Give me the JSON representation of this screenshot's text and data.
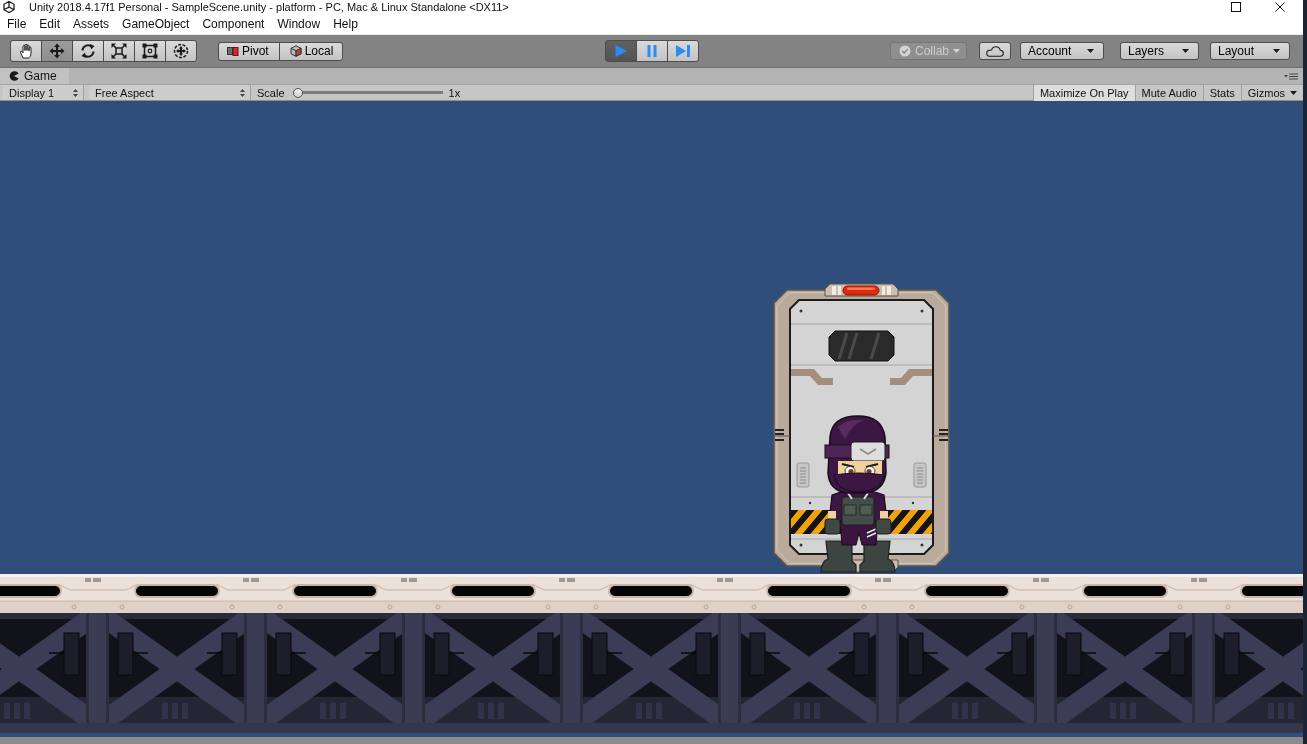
{
  "window": {
    "title": "Unity 2018.4.17f1 Personal - SampleScene.unity - platform - PC, Mac & Linux Standalone <DX11>"
  },
  "menu": [
    "File",
    "Edit",
    "Assets",
    "GameObject",
    "Component",
    "Window",
    "Help"
  ],
  "toolbar": {
    "tools": [
      {
        "kind": "hand",
        "selected": false
      },
      {
        "kind": "move",
        "selected": true
      },
      {
        "kind": "rotate",
        "selected": false
      },
      {
        "kind": "scale",
        "selected": false
      },
      {
        "kind": "rect",
        "selected": false
      },
      {
        "kind": "transform",
        "selected": false
      }
    ],
    "handle_toggles": [
      {
        "kind": "pivot",
        "label": "Pivot"
      },
      {
        "kind": "local",
        "label": "Local"
      }
    ],
    "playback": [
      {
        "kind": "play",
        "selected": true
      },
      {
        "kind": "pause",
        "selected": false
      },
      {
        "kind": "step",
        "selected": false
      }
    ],
    "collab": {
      "label": "Collab",
      "disabled": true
    },
    "account": {
      "label": "Account"
    },
    "layers": {
      "label": "Layers"
    },
    "layout": {
      "label": "Layout"
    }
  },
  "game_panel": {
    "tab": {
      "label": "Game"
    },
    "display": {
      "value": "Display 1"
    },
    "aspect": {
      "value": "Free Aspect"
    },
    "scale": {
      "label": "Scale",
      "level": 0,
      "reading": "1x"
    },
    "toggles": [
      {
        "label": "Maximize On Play",
        "selected": true
      },
      {
        "label": "Mute Audio",
        "selected": false
      },
      {
        "label": "Stats",
        "selected": false
      }
    ],
    "gizmos": {
      "label": "Gizmos"
    }
  }
}
